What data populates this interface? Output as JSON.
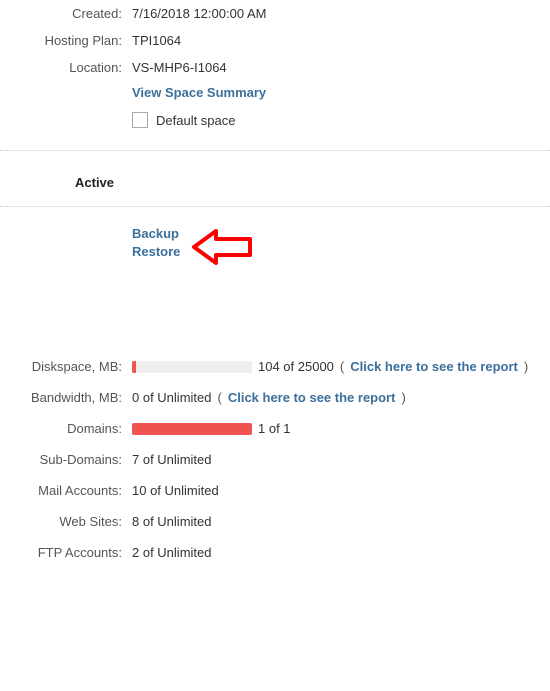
{
  "details": {
    "created_label": "Created:",
    "created_value": "7/16/2018 12:00:00 AM",
    "hosting_plan_label": "Hosting Plan:",
    "hosting_plan_value": "TPI1064",
    "location_label": "Location:",
    "location_value": "VS-MHP6-I1064",
    "view_space_summary": "View Space Summary",
    "default_space": "Default space"
  },
  "status": {
    "label": "Active"
  },
  "actions": {
    "backup": "Backup",
    "restore": "Restore"
  },
  "stats": {
    "diskspace_label": "Diskspace, MB:",
    "diskspace_text": "104 of 25000",
    "diskspace_fill": 3,
    "diskspace_report": "Click here to see the report",
    "bandwidth_label": "Bandwidth, MB:",
    "bandwidth_text": "0 of Unlimited",
    "bandwidth_report": "Click here to see the report",
    "domains_label": "Domains:",
    "domains_text": "1 of 1",
    "domains_fill": 100,
    "sub_domains_label": "Sub-Domains:",
    "sub_domains_text": "7 of Unlimited",
    "mail_accounts_label": "Mail Accounts:",
    "mail_accounts_text": "10 of Unlimited",
    "web_sites_label": "Web Sites:",
    "web_sites_text": "8 of Unlimited",
    "ftp_accounts_label": "FTP Accounts:",
    "ftp_accounts_text": "2 of Unlimited"
  }
}
